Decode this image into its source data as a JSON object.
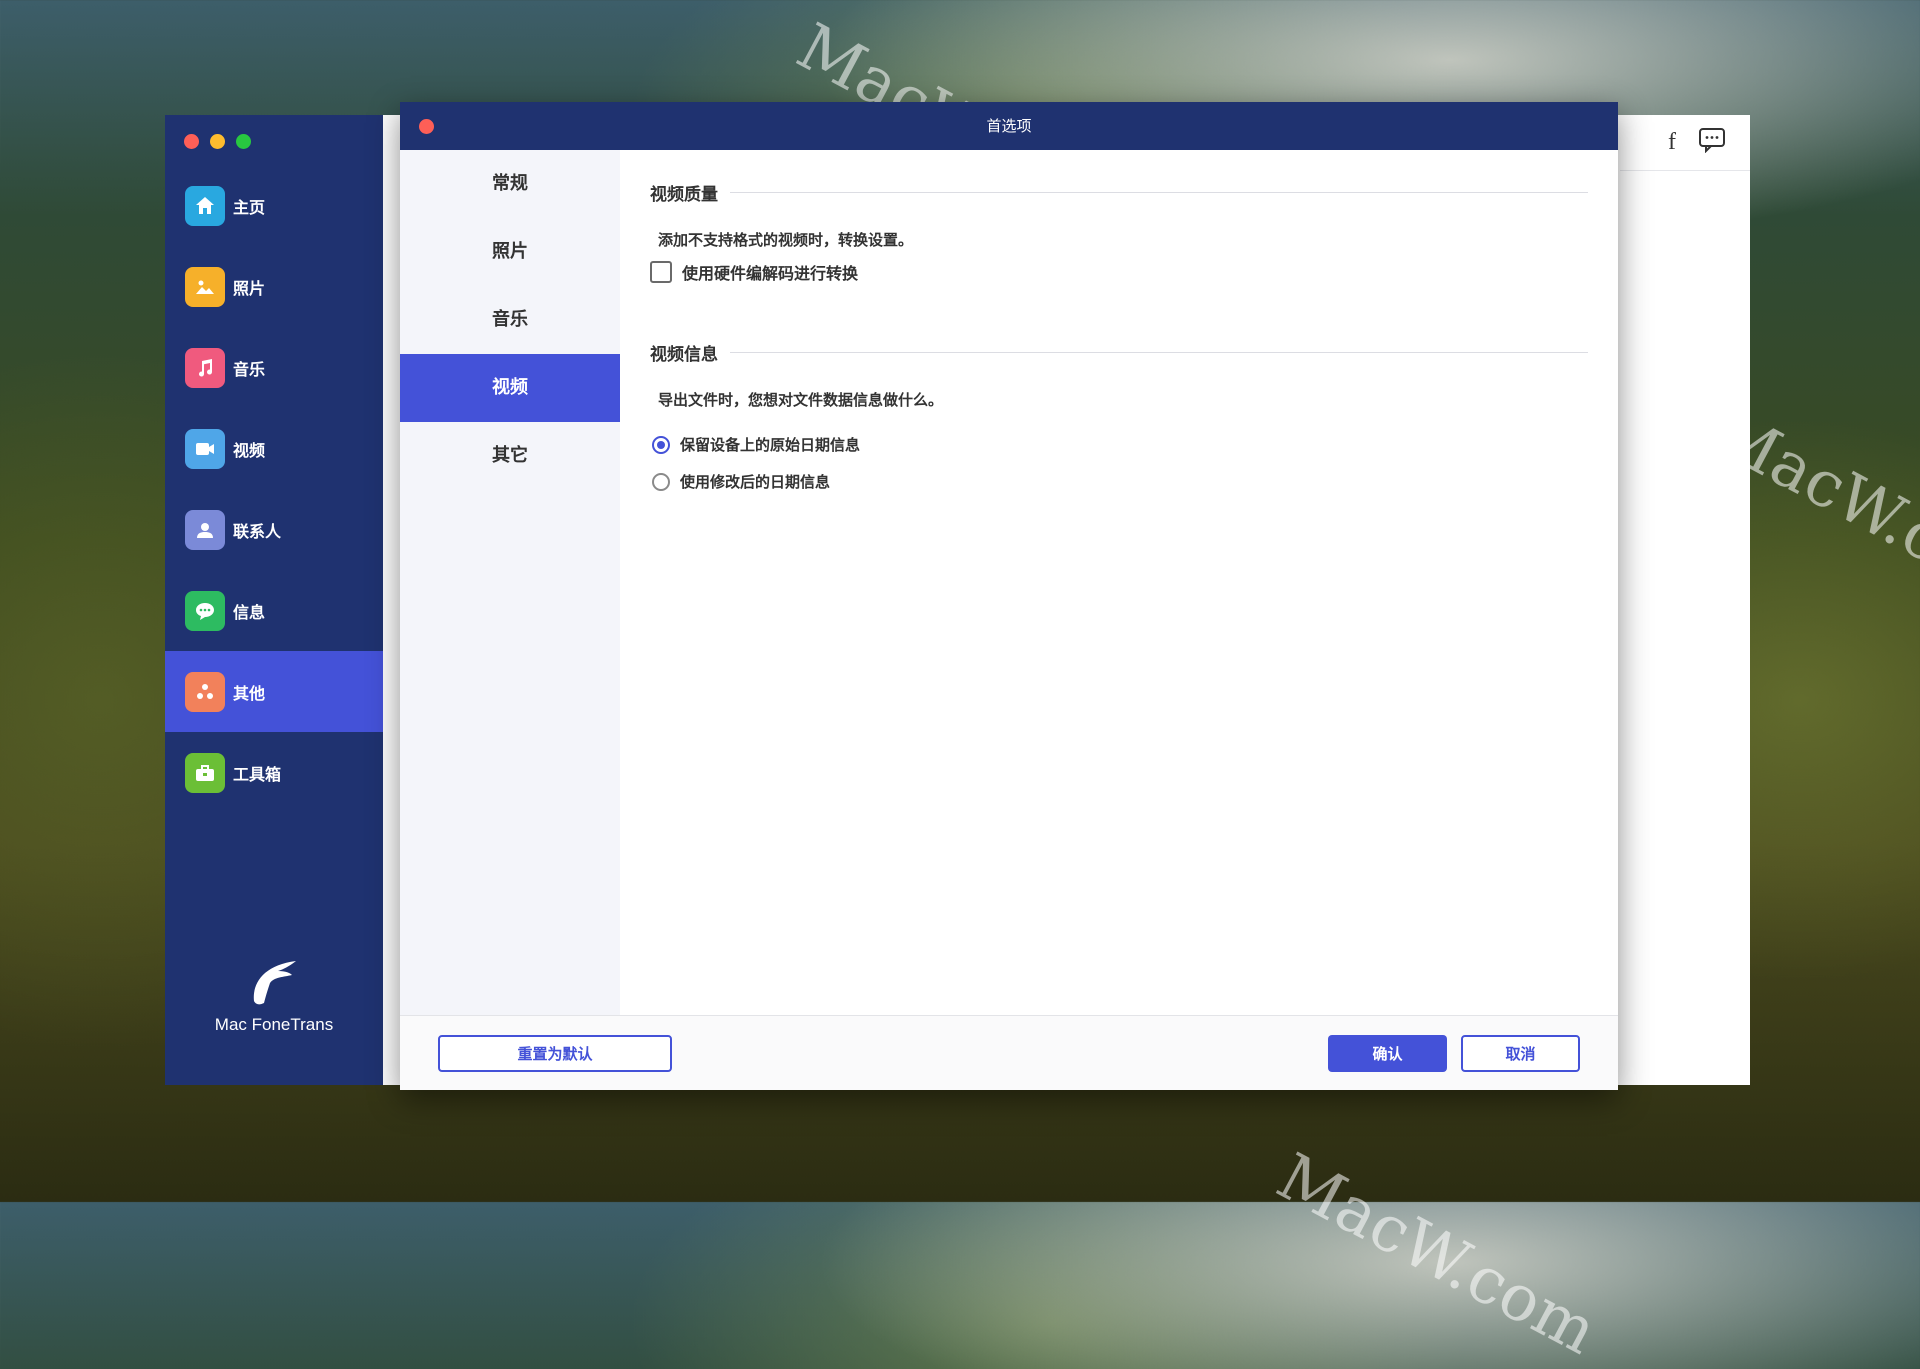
{
  "watermark": "MacW.com",
  "app": {
    "name": "Mac FoneTrans",
    "sidebar": [
      {
        "label": "主页",
        "icon": "home-icon",
        "color": "#29a8e0"
      },
      {
        "label": "照片",
        "icon": "photos-icon",
        "color": "#f6b02a"
      },
      {
        "label": "音乐",
        "icon": "music-icon",
        "color": "#f05a7e"
      },
      {
        "label": "视频",
        "icon": "video-icon",
        "color": "#4fa6e8"
      },
      {
        "label": "联系人",
        "icon": "contacts-icon",
        "color": "#7b8ad8"
      },
      {
        "label": "信息",
        "icon": "messages-icon",
        "color": "#2dbb61"
      },
      {
        "label": "其他",
        "icon": "others-icon",
        "color": "#f2815b",
        "active": true
      },
      {
        "label": "工具箱",
        "icon": "toolbox-icon",
        "color": "#6bbf36"
      }
    ]
  },
  "dialog": {
    "title": "首选项",
    "tabs": [
      "常规",
      "照片",
      "音乐",
      "视频",
      "其它"
    ],
    "active_tab": "视频",
    "video_quality": {
      "heading": "视频质量",
      "description": "添加不支持格式的视频时，转换设置。",
      "hardware_checkbox_label": "使用硬件编解码进行转换",
      "hardware_checked": false
    },
    "video_info": {
      "heading": "视频信息",
      "description": "导出文件时，您想对文件数据信息做什么。",
      "options": [
        "保留设备上的原始日期信息",
        "使用修改后的日期信息"
      ],
      "selected": "保留设备上的原始日期信息"
    },
    "buttons": {
      "reset": "重置为默认",
      "confirm": "确认",
      "cancel": "取消"
    }
  },
  "colors": {
    "accent": "#4452d8",
    "sidebar": "#1f3270"
  }
}
